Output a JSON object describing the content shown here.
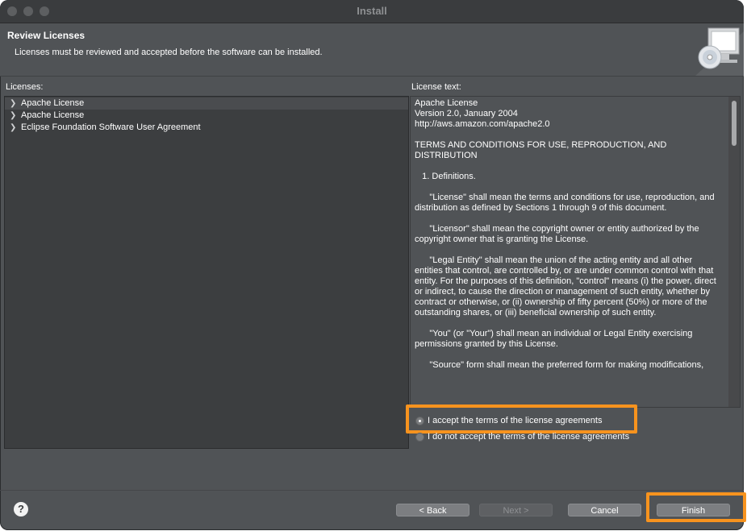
{
  "window": {
    "title": "Install"
  },
  "header": {
    "title": "Review Licenses",
    "subtitle": "Licenses must be reviewed and accepted before the software can be installed."
  },
  "licenses": {
    "label": "Licenses:",
    "items": [
      {
        "label": "Apache License"
      },
      {
        "label": "Apache License"
      },
      {
        "label": "Eclipse Foundation Software User Agreement"
      }
    ]
  },
  "license_text": {
    "label": "License text:",
    "content": "Apache License\nVersion 2.0, January 2004\nhttp://aws.amazon.com/apache2.0\n\nTERMS AND CONDITIONS FOR USE, REPRODUCTION, AND DISTRIBUTION\n\n   1. Definitions.\n\n      \"License\" shall mean the terms and conditions for use, reproduction, and distribution as defined by Sections 1 through 9 of this document.\n\n      \"Licensor\" shall mean the copyright owner or entity authorized by the copyright owner that is granting the License.\n\n      \"Legal Entity\" shall mean the union of the acting entity and all other entities that control, are controlled by, or are under common control with that entity. For the purposes of this definition, \"control\" means (i) the power, direct or indirect, to cause the direction or management of such entity, whether by contract or otherwise, or (ii) ownership of fifty percent (50%) or more of the outstanding shares, or (iii) beneficial ownership of such entity.\n\n      \"You\" (or \"Your\") shall mean an individual or Legal Entity exercising permissions granted by this License.\n\n      \"Source\" form shall mean the preferred form for making modifications,"
  },
  "options": {
    "accept": "I accept the terms of the license agreements",
    "decline": "I do not accept the terms of the license agreements"
  },
  "buttons": {
    "help": "?",
    "back": "< Back",
    "next": "Next >",
    "cancel": "Cancel",
    "finish": "Finish"
  },
  "colors": {
    "highlight": "#f7931e",
    "window_bg": "#505356",
    "panel_bg": "#3c3e40"
  }
}
